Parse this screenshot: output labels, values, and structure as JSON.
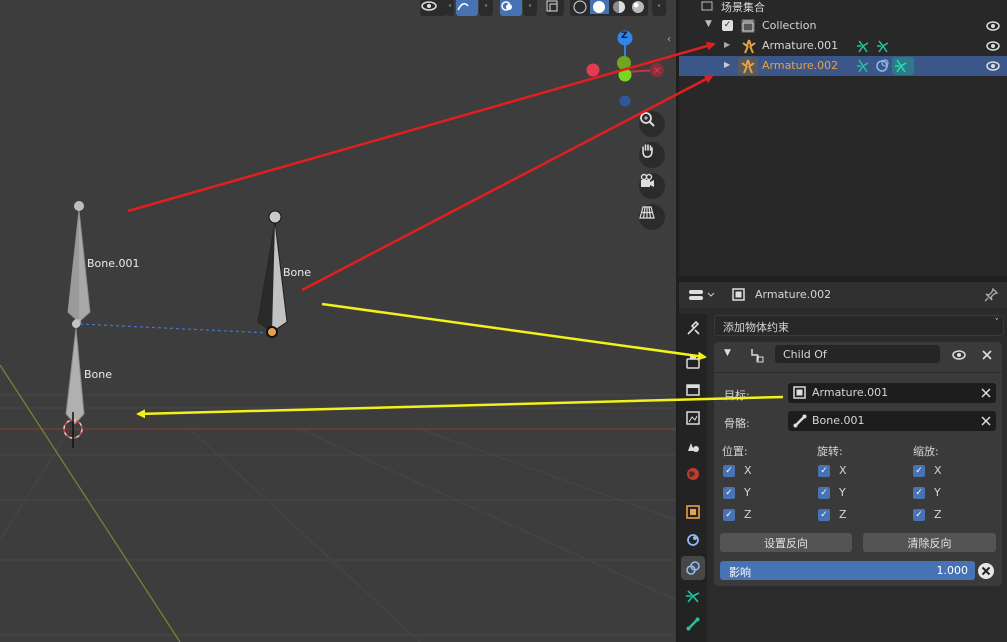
{
  "viewport": {
    "bones": {
      "bone001_label": "Bone.001",
      "bone_a_label": "Bone",
      "bone_b_label": "Bone"
    },
    "gizmo": {
      "z": "Z"
    }
  },
  "outliner": {
    "scene_collection": "场景集合",
    "collection": "Collection",
    "items": [
      {
        "label": "Armature.001",
        "selected": false
      },
      {
        "label": "Armature.002",
        "selected": true
      }
    ]
  },
  "properties": {
    "header_object": "Armature.002",
    "add_constraint": "添加物体约束",
    "constraint_name": "Child Of",
    "target_label": "目标:",
    "target_value": "Armature.001",
    "bone_label": "骨骼:",
    "bone_value": "Bone.001",
    "location_label": "位置:",
    "rotation_label": "旋转:",
    "scale_label": "缩放:",
    "axes": [
      "X",
      "Y",
      "Z"
    ],
    "set_inverse": "设置反向",
    "clear_inverse": "清除反向",
    "influence_label": "影响",
    "influence_value": "1.000",
    "influence": 1.0
  },
  "colors": {
    "accent": "#4772b3",
    "selection": "#3b5689",
    "active_orange": "#e5a14a",
    "bone_icon": "#23c3a0",
    "arrow_red": "#e01f1f",
    "arrow_yellow": "#f2f21a"
  }
}
